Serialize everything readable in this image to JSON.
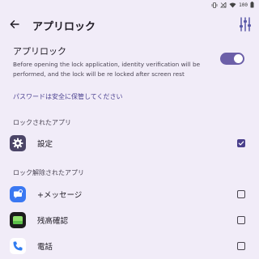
{
  "status_bar": {
    "battery": "100"
  },
  "app_bar": {
    "title": "アプリロック"
  },
  "master": {
    "title": "アプリロック",
    "description": "Before opening the lock application, identity verification will be performed, and the lock will be re locked after screen rest",
    "enabled": true
  },
  "hint": "パスワードは安全に保管してください",
  "locked_section": {
    "header": "ロックされたアプリ",
    "apps": [
      {
        "label": "設定",
        "icon": "gear-icon",
        "checked": true
      }
    ]
  },
  "unlocked_section": {
    "header": "ロック解除されたアプリ",
    "apps": [
      {
        "label": "+メッセージ",
        "icon": "message-icon",
        "checked": false
      },
      {
        "label": "残高確認",
        "icon": "balance-icon",
        "checked": false
      },
      {
        "label": "電話",
        "icon": "phone-icon",
        "checked": false
      }
    ]
  },
  "colors": {
    "background": "#f1ecf8",
    "accent": "#6c5fa8",
    "checkbox_checked": "#4a3f8c",
    "hint_text": "#4c4291"
  }
}
